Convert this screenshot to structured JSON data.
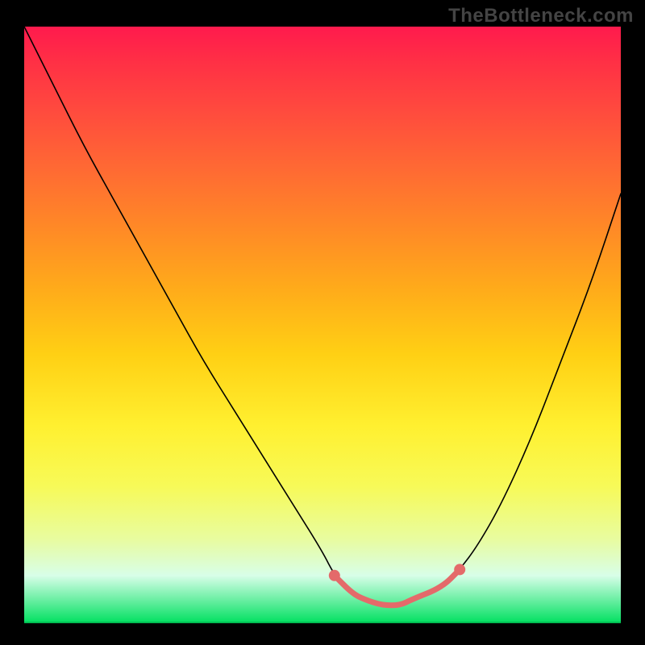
{
  "watermark": "TheBottleneck.com",
  "colors": {
    "gradient_top": "#ff1a4d",
    "gradient_mid": "#ffd014",
    "gradient_bottom": "#00e060",
    "curve": "#000000",
    "highlight": "#e46a6a"
  },
  "chart_data": {
    "type": "line",
    "title": "",
    "xlabel": "",
    "ylabel": "",
    "xlim": [
      0,
      100
    ],
    "ylim": [
      0,
      100
    ],
    "legend": false,
    "grid": false,
    "axes_visible": false,
    "note": "Values are estimated from the image; the plot has no visible axis ticks or labels so x/y are in percent of plot width/height with y=0 at bottom.",
    "series": [
      {
        "name": "curve",
        "x": [
          0,
          5,
          10,
          15,
          20,
          25,
          30,
          35,
          40,
          45,
          50,
          52,
          55,
          57,
          60,
          63,
          65,
          70,
          73,
          76,
          80,
          85,
          90,
          95,
          100
        ],
        "y": [
          100,
          90,
          80,
          71,
          62,
          53,
          44,
          36,
          28,
          20,
          12,
          8,
          5,
          4,
          3,
          3,
          4,
          6,
          9,
          13,
          20,
          31,
          44,
          57,
          72
        ]
      }
    ],
    "highlighted_segment": {
      "name": "optimal-zone",
      "x": [
        52,
        55,
        57,
        60,
        63,
        65,
        70,
        73
      ],
      "y": [
        8,
        5,
        4,
        3,
        3,
        4,
        6,
        9
      ]
    },
    "highlighted_endpoints": {
      "left": {
        "x": 52,
        "y": 8
      },
      "right": {
        "x": 73,
        "y": 9
      }
    }
  }
}
